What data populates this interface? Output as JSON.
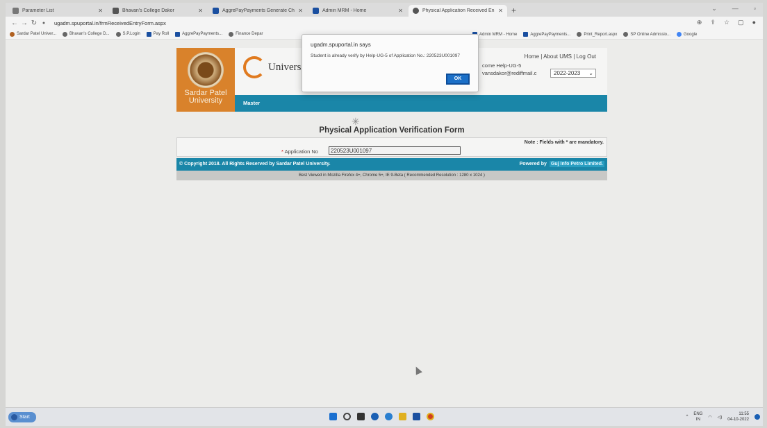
{
  "browser": {
    "tabs": [
      {
        "label": "Parameter List",
        "color": "#777777",
        "active": false
      },
      {
        "label": "Bhavan's College Dakor",
        "color": "#555555",
        "active": false
      },
      {
        "label": "AggrePayPayments Generate Ch",
        "color": "#1a4fa0",
        "active": false
      },
      {
        "label": "Admin MRM - Home",
        "color": "#1a4fa0",
        "active": false
      },
      {
        "label": "Physical Application Received En",
        "color": "#555555",
        "active": true
      }
    ],
    "url": "ugadm.spuportal.in/frmReceivedEntryForm.aspx",
    "bookmarks_left": [
      "Sardar Patel Univer...",
      "Bhavan's College D...",
      "S.P.Login",
      "Pay Roll",
      "AggrePayPayments...",
      "Finance Depar"
    ],
    "bookmarks_right": [
      "Admin MRM - Home",
      "AggrePayPayments...",
      "Print_Report.aspx",
      "SP Online Admissio...",
      "Google"
    ]
  },
  "site": {
    "logo_text": "Sardar Patel University",
    "brand_text": "Universit",
    "header_links": "Home | About UMS | Log Out",
    "welcome_line1": "come Help-UG-5",
    "welcome_line2": "vansdakor@rediffmail.c",
    "year": "2022-2023",
    "menu_master": "Master"
  },
  "form": {
    "title": "Physical Application Verification Form",
    "note": "Note : Fields with * are mandatory.",
    "required_mark": "*",
    "app_label": "Application No",
    "app_value": "220523U001097"
  },
  "footer": {
    "copyright": "© Copyright 2018. All Rights Reserved by Sardar Patel University.",
    "powered_by": "Powered by",
    "company": "Guj Info Petro Limited.",
    "best_viewed": "Best Viewed in Mozilla Firefox 4+, Chrome 5+, IE 9-Beta  ( Recommended Resolution : 1280 x 1024 )"
  },
  "dialog": {
    "title": "ugadm.spuportal.in says",
    "message": "Student is already verify by Help-UG-5 of Application No.: 220523U001097",
    "ok_label": "OK"
  },
  "taskbar": {
    "start_label": "Start",
    "lang": "ENG",
    "region": "IN",
    "time": "11:55",
    "date": "04-10-2022",
    "icon_colors": [
      "#1a6fd0",
      "#444444",
      "#333333",
      "#1a5fb4",
      "#2a7fd0",
      "#e0b020",
      "#1a4fa0",
      "#d04020"
    ]
  }
}
